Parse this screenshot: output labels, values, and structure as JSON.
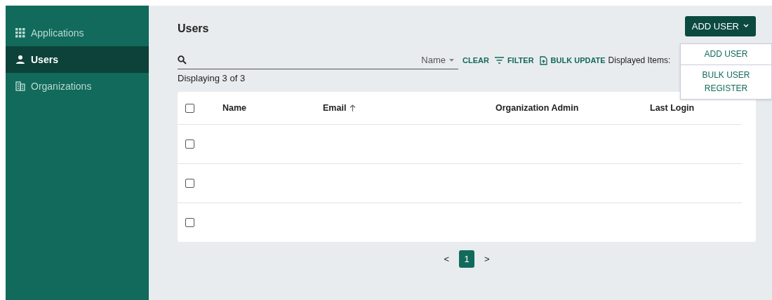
{
  "sidebar": {
    "items": [
      {
        "label": "Applications",
        "selected": false
      },
      {
        "label": "Users",
        "selected": true
      },
      {
        "label": "Organizations",
        "selected": false
      }
    ]
  },
  "page": {
    "title": "Users"
  },
  "add_user": {
    "label": "ADD USER",
    "expanded": true,
    "menu": [
      {
        "label": "ADD USER"
      },
      {
        "label": "BULK USER REGISTER"
      }
    ]
  },
  "toolbar": {
    "sort_field": "Name",
    "clear": "CLEAR",
    "filter": "FILTER",
    "bulk_update": "BULK UPDATE",
    "displayed_items": "Displayed Items:"
  },
  "count": "Displaying 3 of 3",
  "table": {
    "header_checked": false,
    "columns": [
      {
        "label": "Name",
        "sorted": false
      },
      {
        "label": "Email",
        "sorted": true
      },
      {
        "label": "Organization Admin",
        "sorted": false
      },
      {
        "label": "Last Login",
        "sorted": false
      }
    ],
    "rows": [
      {
        "checked": false
      },
      {
        "checked": false
      },
      {
        "checked": false
      }
    ]
  },
  "pagination": {
    "prev": "<",
    "next": ">",
    "pages": [
      {
        "label": "1",
        "selected": true
      }
    ]
  }
}
